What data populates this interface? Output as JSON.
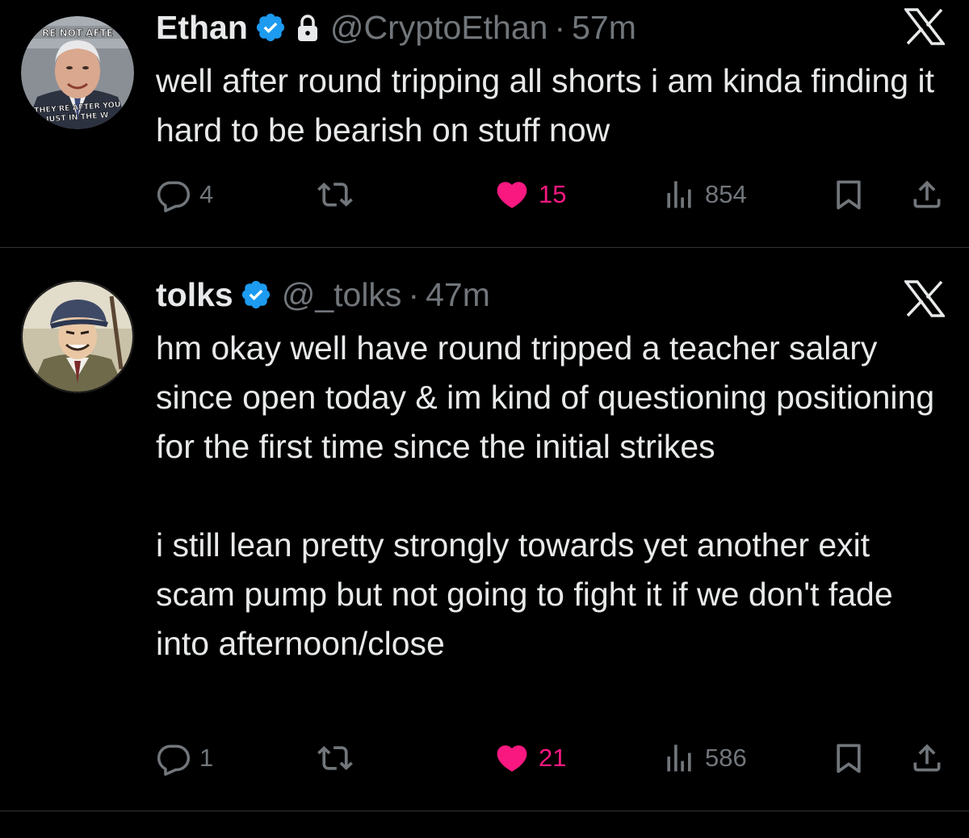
{
  "tweets": [
    {
      "display_name": "Ethan",
      "handle": "@CryptoEthan",
      "separator": "·",
      "time": "57m",
      "verified": true,
      "protected": true,
      "avatar_icon": "jerome-powell-meme-avatar",
      "avatar_text_top": "RE NOT AFTE",
      "avatar_text_bottom": "THEY'RE AFTER YOU JUST IN THE W",
      "text": [
        "well after round tripping all shorts i am kinda finding it hard to be bearish on stuff now"
      ],
      "replies": "4",
      "retweets": "",
      "likes": "15",
      "views": "854",
      "liked": true
    },
    {
      "display_name": "tolks",
      "handle": "@_tolks",
      "separator": "·",
      "time": "47m",
      "verified": true,
      "protected": false,
      "avatar_icon": "anime-flat-cap-character-avatar",
      "text": [
        "hm okay well have round tripped a teacher salary since open today & im kind of questioning positioning for the first time since the initial strikes",
        "i still lean pretty strongly towards yet another exit scam pump but not going to fight it if we don't fade into afternoon/close"
      ],
      "replies": "1",
      "retweets": "",
      "likes": "21",
      "views": "586",
      "liked": true
    }
  ],
  "colors": {
    "background": "#000000",
    "text_primary": "#e7e9ea",
    "text_secondary": "#71767b",
    "verified_blue": "#1d9bf0",
    "like_pink": "#f91880",
    "divider": "#2f3336"
  }
}
